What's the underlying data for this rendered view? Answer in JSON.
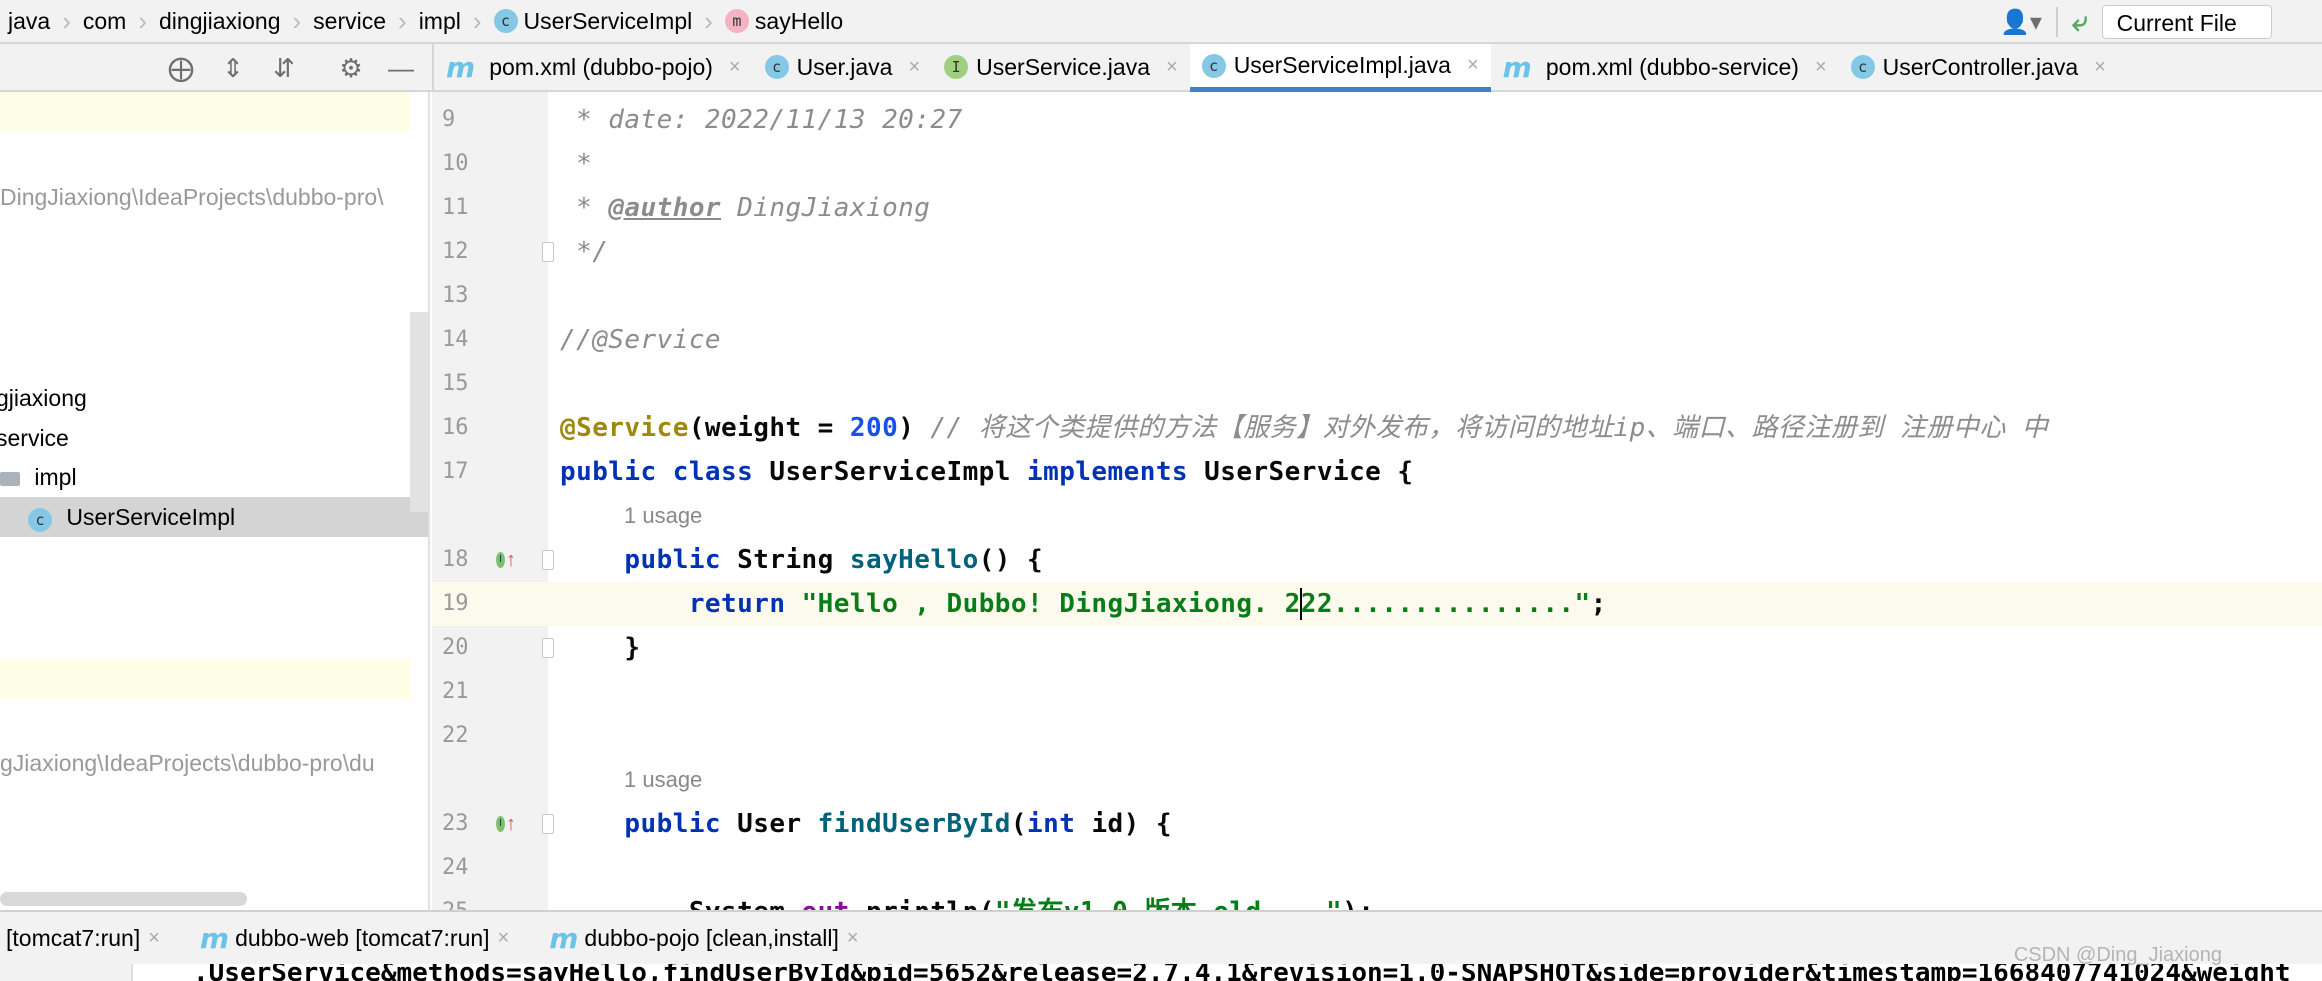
{
  "breadcrumb": [
    {
      "label": "java",
      "icon": ""
    },
    {
      "label": "com",
      "icon": ""
    },
    {
      "label": "dingjiaxiong",
      "icon": ""
    },
    {
      "label": "service",
      "icon": ""
    },
    {
      "label": "impl",
      "icon": ""
    },
    {
      "label": "UserServiceImpl",
      "icon": "class-icon"
    },
    {
      "label": "sayHello",
      "icon": "method-icon"
    }
  ],
  "toolbar": {
    "run_config": "Current File"
  },
  "tabs": [
    {
      "label": "pom.xml (dubbo-pojo)",
      "icon": "maven-icon",
      "active": false
    },
    {
      "label": "User.java",
      "icon": "class-icon",
      "active": false
    },
    {
      "label": "UserService.java",
      "icon": "interface-icon",
      "active": false
    },
    {
      "label": "UserServiceImpl.java",
      "icon": "class-icon",
      "active": true
    },
    {
      "label": "pom.xml (dubbo-service)",
      "icon": "maven-icon",
      "active": false
    },
    {
      "label": "UserController.java",
      "icon": "class-icon",
      "active": false
    }
  ],
  "sidebar": {
    "path1": "DingJiaxiong\\IdeaProjects\\dubbo-pro\\",
    "pkg": "gjiaxiong",
    "service": "service",
    "impl": "impl",
    "selected": "UserServiceImpl",
    "path2": "gJiaxiong\\IdeaProjects\\dubbo-pro\\du"
  },
  "editor": {
    "current_line": "19",
    "rows": [
      {
        "n": "9",
        "t": [
          [
            "comment",
            " * date: 2022/11/13 20:27"
          ]
        ]
      },
      {
        "n": "10",
        "t": [
          [
            "comment",
            " *"
          ]
        ]
      },
      {
        "n": "11",
        "t": [
          [
            "comment",
            " * "
          ],
          [
            "tag",
            "@author"
          ],
          [
            "comment",
            " DingJiaxiong"
          ]
        ],
        "fold": false
      },
      {
        "n": "12",
        "t": [
          [
            "comment",
            " */"
          ]
        ],
        "fold": true
      },
      {
        "n": "13",
        "t": []
      },
      {
        "n": "14",
        "t": [
          [
            "comment",
            "//@Service"
          ]
        ]
      },
      {
        "n": "15",
        "t": []
      },
      {
        "n": "16",
        "t": [
          [
            "annotation",
            "@Service"
          ],
          [
            "plain",
            "(weight = "
          ],
          [
            "number",
            "200"
          ],
          [
            "plain",
            ") "
          ],
          [
            "comment",
            "// 将这个类提供的方法【服务】对外发布，将访问的地址ip、端口、路径注册到 注册中心 中"
          ]
        ]
      },
      {
        "n": "17",
        "t": [
          [
            "keyword",
            "public class "
          ],
          [
            "plain",
            "UserServiceImpl "
          ],
          [
            "keyword",
            "implements "
          ],
          [
            "plain",
            "UserService {"
          ]
        ]
      },
      {
        "usage": "1 usage"
      },
      {
        "n": "18",
        "t": [
          [
            "keyword",
            "    public "
          ],
          [
            "plain",
            "String "
          ],
          [
            "method",
            "sayHello"
          ],
          [
            "plain",
            "() {"
          ]
        ],
        "fold": true,
        "impl": true
      },
      {
        "n": "19",
        "t": [
          [
            "keyword",
            "        return "
          ],
          [
            "string",
            "\"Hello , Dubbo! DingJiaxiong. 222...............\""
          ],
          [
            "plain",
            ";"
          ]
        ]
      },
      {
        "n": "20",
        "t": [
          [
            "plain",
            "    }"
          ]
        ],
        "fold": true
      },
      {
        "n": "21",
        "t": []
      },
      {
        "n": "22",
        "t": []
      },
      {
        "usage": "1 usage"
      },
      {
        "n": "23",
        "t": [
          [
            "keyword",
            "    public "
          ],
          [
            "plain",
            "User "
          ],
          [
            "method",
            "findUserById"
          ],
          [
            "plain",
            "("
          ],
          [
            "keyword",
            "int "
          ],
          [
            "plain",
            "id) {"
          ]
        ],
        "fold": true,
        "impl": true
      },
      {
        "n": "24",
        "t": []
      },
      {
        "n": "25",
        "t": [
          [
            "plain",
            "        System."
          ],
          [
            "field",
            "out"
          ],
          [
            "plain",
            ".println("
          ],
          [
            "string",
            "\"发布v1.0 版本 old ...\""
          ],
          [
            "plain",
            ");"
          ]
        ]
      }
    ]
  },
  "bottom": {
    "tabs": [
      {
        "label": "[tomcat7:run]",
        "icon": ""
      },
      {
        "label": "dubbo-web [tomcat7:run]",
        "icon": "maven-icon"
      },
      {
        "label": "dubbo-pojo [clean,install]",
        "icon": "maven-icon"
      }
    ],
    "console": ".UserService&methods=sayHello,findUserById&pid=5652&release=2.7.4.1&revision=1.0-SNAPSHOT&side=provider&timestamp=1668407741024&weight"
  },
  "watermark": "CSDN @Ding_Jiaxiong"
}
